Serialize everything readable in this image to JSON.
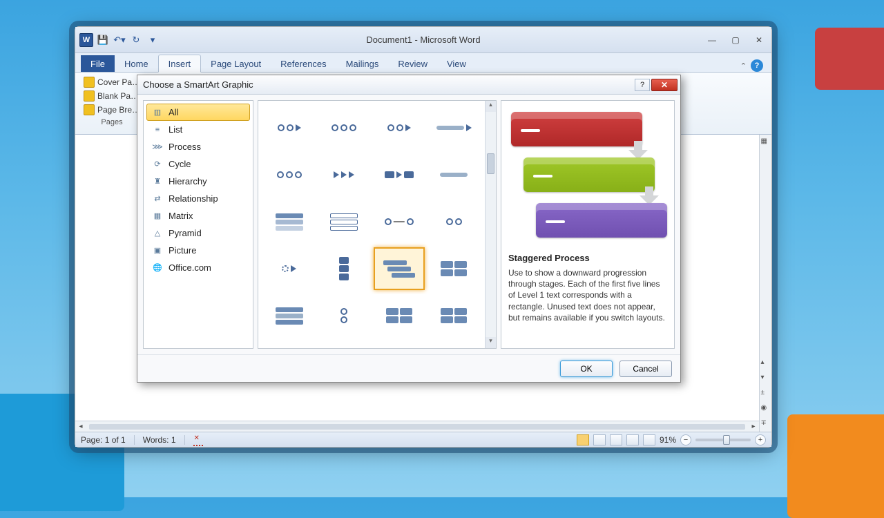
{
  "window": {
    "title": "Document1 - Microsoft Word",
    "minimize": "—",
    "maximize": "▢",
    "close": "✕"
  },
  "ribbon": {
    "tabs": [
      "File",
      "Home",
      "Insert",
      "Page Layout",
      "References",
      "Mailings",
      "Review",
      "View"
    ],
    "insert_group": {
      "items": [
        "Cover Pa…",
        "Blank Pa…",
        "Page Bre…"
      ],
      "label": "Pages"
    }
  },
  "dialog": {
    "title": "Choose a SmartArt Graphic",
    "categories": [
      "All",
      "List",
      "Process",
      "Cycle",
      "Hierarchy",
      "Relationship",
      "Matrix",
      "Pyramid",
      "Picture",
      "Office.com"
    ],
    "preview": {
      "title": "Staggered Process",
      "description": "Use to show a downward progression through stages. Each of the first five lines of Level 1 text corresponds with a rectangle. Unused text does not appear, but remains available if you switch layouts."
    },
    "buttons": {
      "ok": "OK",
      "cancel": "Cancel"
    }
  },
  "status": {
    "page": "Page: 1 of 1",
    "words": "Words: 1",
    "zoom": "91%"
  }
}
